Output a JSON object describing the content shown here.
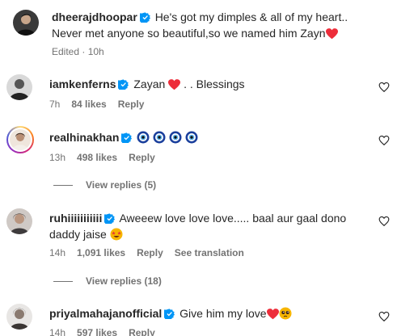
{
  "caption": {
    "username": "dheerajdhoopar",
    "line1": "He's got my dimples & all of my heart..",
    "line2": "Never met anyone so beautiful,so we named him Zayn",
    "meta": "Edited · 10h"
  },
  "comments": [
    {
      "username": "iamkenferns",
      "text": "Zayan",
      "text_after": " . . Blessings",
      "time": "7h",
      "likes": "84 likes",
      "reply": "Reply"
    },
    {
      "username": "realhinakhan",
      "text": "",
      "time": "13h",
      "likes": "498 likes",
      "reply": "Reply",
      "view_replies": "View replies (5)"
    },
    {
      "username": "ruhiiiiiiiiiii",
      "text_line1": "Aweeew love love love..... baal aur gaal dono",
      "text_line2": "daddy jaise",
      "time": "14h",
      "likes": "1,091 likes",
      "reply": "Reply",
      "translate": "See translation",
      "view_replies": "View replies (18)"
    },
    {
      "username": "priyalmahajanofficial",
      "text": "Give him my love",
      "time": "14h",
      "likes": "597 likes",
      "reply": "Reply"
    }
  ],
  "colors": {
    "verified": "#0095f6",
    "heart_red": "#ed2d3a",
    "nazar_blue": "#1a3f9c",
    "muted": "#737373",
    "text": "#262626"
  },
  "icons": [
    "verified-badge-icon",
    "red-heart-emoji",
    "evil-eye-emoji",
    "star-struck-emoji",
    "pleading-face-emoji",
    "like-heart-icon"
  ]
}
